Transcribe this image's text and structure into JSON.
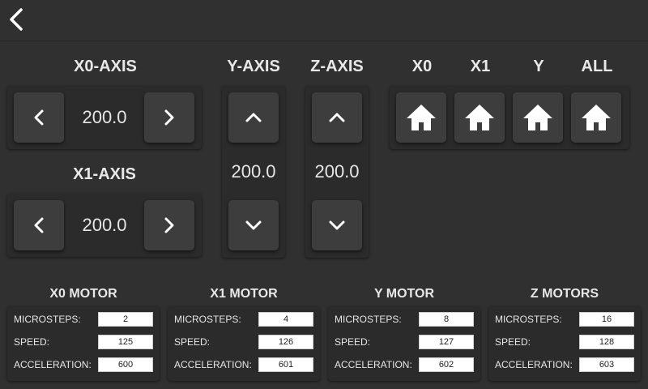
{
  "header": {
    "back_icon": "chevron-left-icon"
  },
  "x0_axis": {
    "title": "X0-AXIS",
    "value": "200.0"
  },
  "x1_axis": {
    "title": "X1-AXIS",
    "value": "200.0"
  },
  "y_axis": {
    "title": "Y-AXIS",
    "value": "200.0"
  },
  "z_axis": {
    "title": "Z-AXIS",
    "value": "200.0"
  },
  "home": {
    "buttons": [
      {
        "label": "X0",
        "icon": "home-icon"
      },
      {
        "label": "X1",
        "icon": "home-icon"
      },
      {
        "label": "Y",
        "icon": "home-icon"
      },
      {
        "label": "ALL",
        "icon": "home-icon"
      }
    ]
  },
  "motors": [
    {
      "title": "X0 MOTOR",
      "microsteps_label": "MICROSTEPS:",
      "microsteps": "2",
      "speed_label": "SPEED:",
      "speed": "125",
      "accel_label": "ACCELERATION:",
      "accel": "600"
    },
    {
      "title": "X1 MOTOR",
      "microsteps_label": "MICROSTEPS:",
      "microsteps": "4",
      "speed_label": "SPEED:",
      "speed": "126",
      "accel_label": "ACCELERATION:",
      "accel": "601"
    },
    {
      "title": "Y MOTOR",
      "microsteps_label": "MICROSTEPS:",
      "microsteps": "8",
      "speed_label": "SPEED:",
      "speed": "127",
      "accel_label": "ACCELERATION:",
      "accel": "602"
    },
    {
      "title": "Z MOTORS",
      "microsteps_label": "MICROSTEPS:",
      "microsteps": "16",
      "speed_label": "SPEED:",
      "speed": "128",
      "accel_label": "ACCELERATION:",
      "accel": "603"
    }
  ],
  "colors": {
    "background": "#303030",
    "panel": "#2b2b2b",
    "button": "#3d3d3d",
    "text": "#e6e6e6"
  }
}
